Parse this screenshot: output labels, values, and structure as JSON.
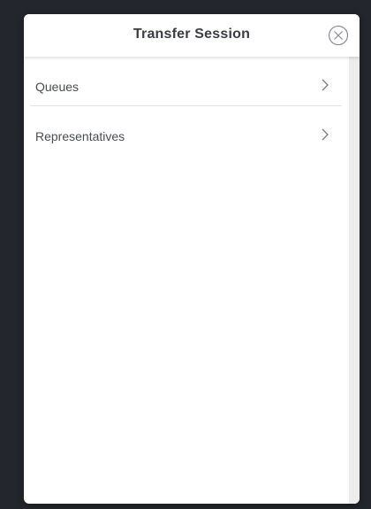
{
  "dialog": {
    "title": "Transfer Session",
    "close_icon": "close-circle-icon"
  },
  "list": {
    "items": [
      {
        "label": "Queues",
        "icon": "chevron-right-icon"
      },
      {
        "label": "Representatives",
        "icon": "chevron-right-icon"
      }
    ]
  },
  "colors": {
    "backdrop": "#23262c",
    "panel": "#ffffff",
    "text": "#4a4d53",
    "title": "#3a3d42",
    "scrollbar_track": "#ededed"
  }
}
